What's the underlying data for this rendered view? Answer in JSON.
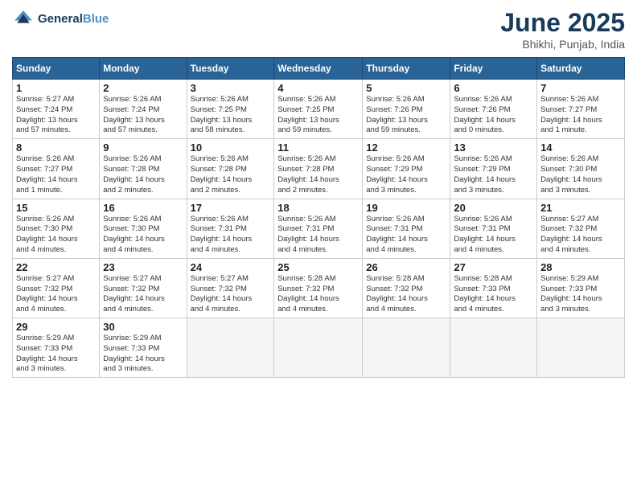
{
  "header": {
    "logo_line1": "General",
    "logo_line2": "Blue",
    "month_title": "June 2025",
    "location": "Bhikhi, Punjab, India"
  },
  "weekdays": [
    "Sunday",
    "Monday",
    "Tuesday",
    "Wednesday",
    "Thursday",
    "Friday",
    "Saturday"
  ],
  "weeks": [
    [
      {
        "day": "1",
        "info": "Sunrise: 5:27 AM\nSunset: 7:24 PM\nDaylight: 13 hours\nand 57 minutes."
      },
      {
        "day": "2",
        "info": "Sunrise: 5:26 AM\nSunset: 7:24 PM\nDaylight: 13 hours\nand 57 minutes."
      },
      {
        "day": "3",
        "info": "Sunrise: 5:26 AM\nSunset: 7:25 PM\nDaylight: 13 hours\nand 58 minutes."
      },
      {
        "day": "4",
        "info": "Sunrise: 5:26 AM\nSunset: 7:25 PM\nDaylight: 13 hours\nand 59 minutes."
      },
      {
        "day": "5",
        "info": "Sunrise: 5:26 AM\nSunset: 7:26 PM\nDaylight: 13 hours\nand 59 minutes."
      },
      {
        "day": "6",
        "info": "Sunrise: 5:26 AM\nSunset: 7:26 PM\nDaylight: 14 hours\nand 0 minutes."
      },
      {
        "day": "7",
        "info": "Sunrise: 5:26 AM\nSunset: 7:27 PM\nDaylight: 14 hours\nand 1 minute."
      }
    ],
    [
      {
        "day": "8",
        "info": "Sunrise: 5:26 AM\nSunset: 7:27 PM\nDaylight: 14 hours\nand 1 minute."
      },
      {
        "day": "9",
        "info": "Sunrise: 5:26 AM\nSunset: 7:28 PM\nDaylight: 14 hours\nand 2 minutes."
      },
      {
        "day": "10",
        "info": "Sunrise: 5:26 AM\nSunset: 7:28 PM\nDaylight: 14 hours\nand 2 minutes."
      },
      {
        "day": "11",
        "info": "Sunrise: 5:26 AM\nSunset: 7:28 PM\nDaylight: 14 hours\nand 2 minutes."
      },
      {
        "day": "12",
        "info": "Sunrise: 5:26 AM\nSunset: 7:29 PM\nDaylight: 14 hours\nand 3 minutes."
      },
      {
        "day": "13",
        "info": "Sunrise: 5:26 AM\nSunset: 7:29 PM\nDaylight: 14 hours\nand 3 minutes."
      },
      {
        "day": "14",
        "info": "Sunrise: 5:26 AM\nSunset: 7:30 PM\nDaylight: 14 hours\nand 3 minutes."
      }
    ],
    [
      {
        "day": "15",
        "info": "Sunrise: 5:26 AM\nSunset: 7:30 PM\nDaylight: 14 hours\nand 4 minutes."
      },
      {
        "day": "16",
        "info": "Sunrise: 5:26 AM\nSunset: 7:30 PM\nDaylight: 14 hours\nand 4 minutes."
      },
      {
        "day": "17",
        "info": "Sunrise: 5:26 AM\nSunset: 7:31 PM\nDaylight: 14 hours\nand 4 minutes."
      },
      {
        "day": "18",
        "info": "Sunrise: 5:26 AM\nSunset: 7:31 PM\nDaylight: 14 hours\nand 4 minutes."
      },
      {
        "day": "19",
        "info": "Sunrise: 5:26 AM\nSunset: 7:31 PM\nDaylight: 14 hours\nand 4 minutes."
      },
      {
        "day": "20",
        "info": "Sunrise: 5:26 AM\nSunset: 7:31 PM\nDaylight: 14 hours\nand 4 minutes."
      },
      {
        "day": "21",
        "info": "Sunrise: 5:27 AM\nSunset: 7:32 PM\nDaylight: 14 hours\nand 4 minutes."
      }
    ],
    [
      {
        "day": "22",
        "info": "Sunrise: 5:27 AM\nSunset: 7:32 PM\nDaylight: 14 hours\nand 4 minutes."
      },
      {
        "day": "23",
        "info": "Sunrise: 5:27 AM\nSunset: 7:32 PM\nDaylight: 14 hours\nand 4 minutes."
      },
      {
        "day": "24",
        "info": "Sunrise: 5:27 AM\nSunset: 7:32 PM\nDaylight: 14 hours\nand 4 minutes."
      },
      {
        "day": "25",
        "info": "Sunrise: 5:28 AM\nSunset: 7:32 PM\nDaylight: 14 hours\nand 4 minutes."
      },
      {
        "day": "26",
        "info": "Sunrise: 5:28 AM\nSunset: 7:32 PM\nDaylight: 14 hours\nand 4 minutes."
      },
      {
        "day": "27",
        "info": "Sunrise: 5:28 AM\nSunset: 7:33 PM\nDaylight: 14 hours\nand 4 minutes."
      },
      {
        "day": "28",
        "info": "Sunrise: 5:29 AM\nSunset: 7:33 PM\nDaylight: 14 hours\nand 3 minutes."
      }
    ],
    [
      {
        "day": "29",
        "info": "Sunrise: 5:29 AM\nSunset: 7:33 PM\nDaylight: 14 hours\nand 3 minutes."
      },
      {
        "day": "30",
        "info": "Sunrise: 5:29 AM\nSunset: 7:33 PM\nDaylight: 14 hours\nand 3 minutes."
      },
      {
        "day": "",
        "info": ""
      },
      {
        "day": "",
        "info": ""
      },
      {
        "day": "",
        "info": ""
      },
      {
        "day": "",
        "info": ""
      },
      {
        "day": "",
        "info": ""
      }
    ]
  ]
}
